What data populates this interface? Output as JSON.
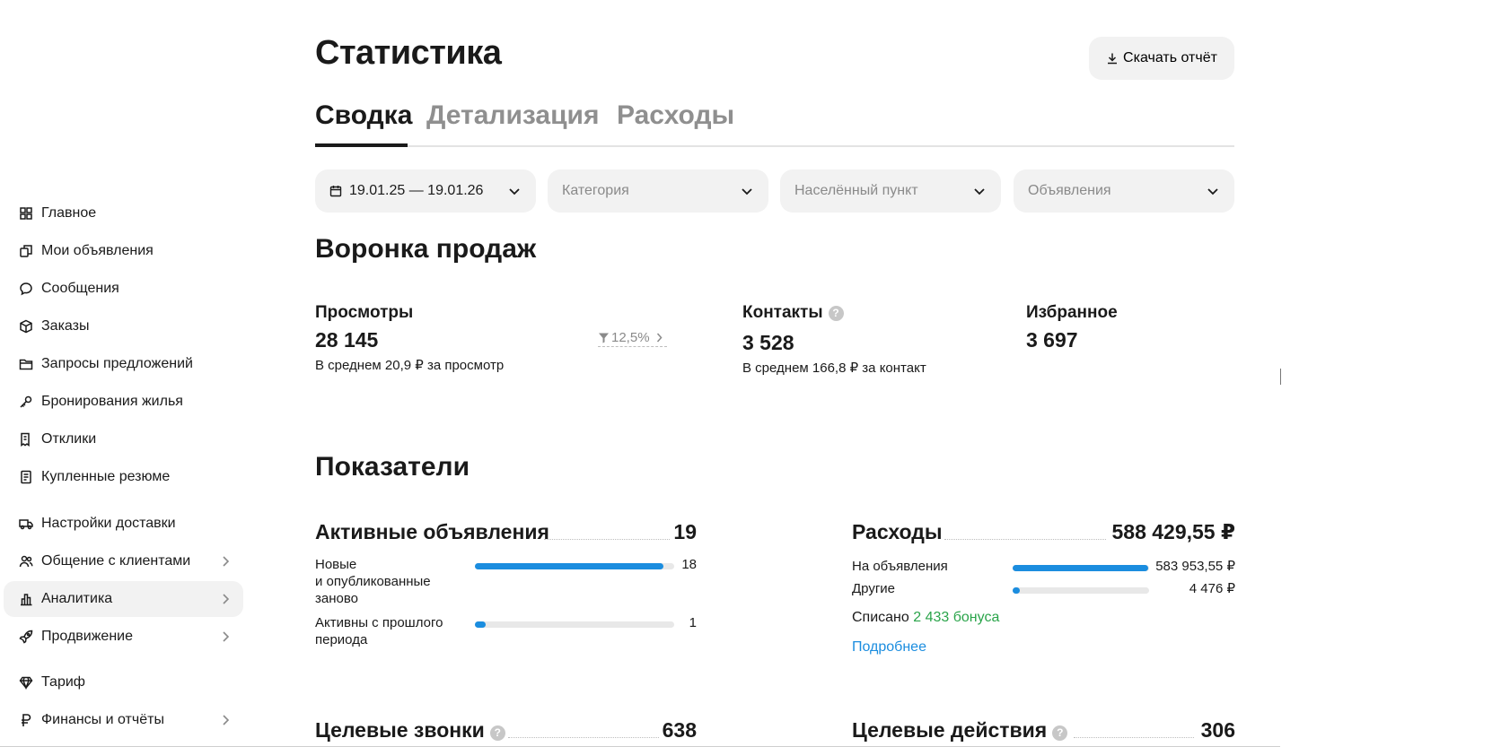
{
  "sidebar": {
    "items": [
      {
        "label": "Главное",
        "icon": "grid-icon",
        "active": false,
        "chevron": false
      },
      {
        "label": "Мои объявления",
        "icon": "copy-icon",
        "active": false,
        "chevron": false
      },
      {
        "label": "Сообщения",
        "icon": "chat-bubble-icon",
        "active": false,
        "chevron": false
      },
      {
        "label": "Заказы",
        "icon": "box-icon",
        "active": false,
        "chevron": false
      },
      {
        "label": "Запросы предложений",
        "icon": "folder-icon",
        "active": false,
        "chevron": false
      },
      {
        "label": "Бронирования жилья",
        "icon": "key-icon",
        "active": false,
        "chevron": false
      },
      {
        "label": "Отклики",
        "icon": "document-icon",
        "active": false,
        "chevron": false
      },
      {
        "label": "Купленные резюме",
        "icon": "resume-icon",
        "active": false,
        "chevron": false
      },
      {
        "label": "Настройки доставки",
        "icon": "truck-icon",
        "active": false,
        "chevron": false
      },
      {
        "label": "Общение с клиентами",
        "icon": "people-icon",
        "active": false,
        "chevron": true
      },
      {
        "label": "Аналитика",
        "icon": "bar-chart-icon",
        "active": true,
        "chevron": true
      },
      {
        "label": "Продвижение",
        "icon": "rocket-icon",
        "active": false,
        "chevron": true
      },
      {
        "label": "Тариф",
        "icon": "diamond-icon",
        "active": false,
        "chevron": false
      },
      {
        "label": "Финансы и отчёты",
        "icon": "ruble-icon",
        "active": false,
        "chevron": true
      }
    ]
  },
  "header": {
    "title": "Статистика",
    "download_label": "Скачать отчёт"
  },
  "tabs": [
    {
      "label": "Сводка",
      "active": true
    },
    {
      "label": "Детализация",
      "active": false
    },
    {
      "label": "Расходы",
      "active": false
    }
  ],
  "filters": {
    "date": "19.01.25 — 19.01.26",
    "category": "Категория",
    "city": "Населённый пункт",
    "ads": "Объявления"
  },
  "funnel": {
    "title": "Воронка продаж",
    "views": {
      "label": "Просмотры",
      "value": "28 145",
      "sub": "В среднем 20,9 ₽ за просмотр",
      "conversion": "12,5%"
    },
    "contacts": {
      "label": "Контакты",
      "value": "3 528",
      "sub": "В среднем 166,8 ₽ за контакт"
    },
    "favorites": {
      "label": "Избранное",
      "value": "3 697"
    }
  },
  "indicators": {
    "title": "Показатели",
    "active_ads": {
      "title": "Активные объявления",
      "value": "19",
      "rows": [
        {
          "label_lines": [
            "Новые",
            "и опубликованные",
            "заново"
          ],
          "value": "18",
          "fill": 0.947
        },
        {
          "label_lines": [
            "Активны с прошлого",
            "периода"
          ],
          "value": "1",
          "fill": 0.053
        }
      ]
    },
    "expenses": {
      "title": "Расходы",
      "value": "588 429,55 ₽",
      "rows": [
        {
          "label": "На объявления",
          "value": "583 953,55 ₽",
          "fill": 0.992
        },
        {
          "label": "Другие",
          "value": "4 476 ₽",
          "fill": 0.05
        }
      ],
      "written_off_prefix": "Списано",
      "written_off_bonus": "2 433 бонуса",
      "more_link": "Подробнее"
    },
    "target_calls": {
      "title": "Целевые звонки",
      "value": "638"
    },
    "target_actions": {
      "title": "Целевые действия",
      "value": "306"
    }
  },
  "colors": {
    "accent_blue": "#1b8ddf",
    "bonus_green": "#2aa44a",
    "surface_gray": "#f2f2f2"
  }
}
